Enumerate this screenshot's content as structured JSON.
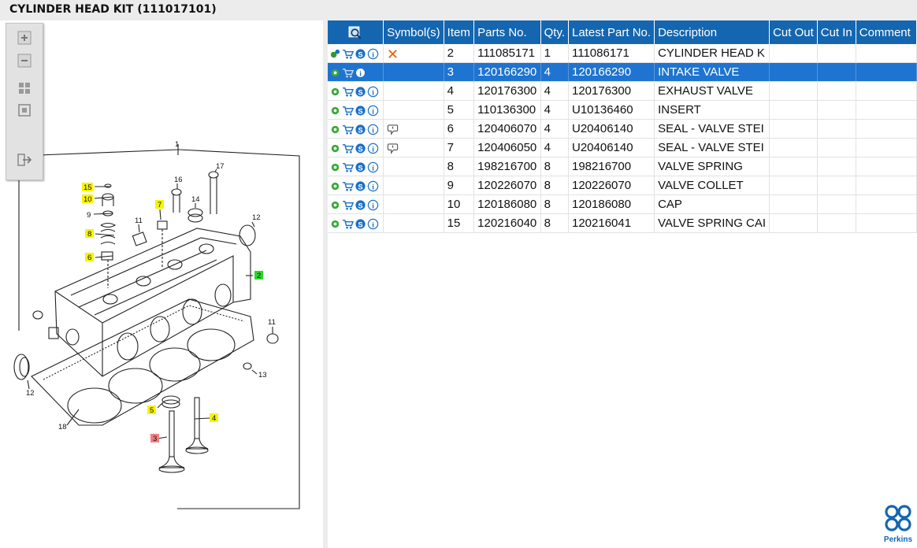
{
  "title": "CYLINDER HEAD KIT (111017101)",
  "table": {
    "headers": [
      "",
      "Symbol(s)",
      "Item",
      "Parts No.",
      "Qty.",
      "Latest Part No.",
      "Description",
      "Cut Out",
      "Cut In",
      "Comment"
    ],
    "rows": [
      {
        "item": "2",
        "parts_no": "111085171",
        "qty": "1",
        "latest": "111086171",
        "desc": "CYLINDER HEAD K",
        "symbol": "x"
      },
      {
        "item": "3",
        "parts_no": "120166290",
        "qty": "4",
        "latest": "120166290",
        "desc": "INTAKE VALVE",
        "symbol": ""
      },
      {
        "item": "4",
        "parts_no": "120176300",
        "qty": "4",
        "latest": "120176300",
        "desc": "EXHAUST VALVE",
        "symbol": ""
      },
      {
        "item": "5",
        "parts_no": "110136300",
        "qty": "4",
        "latest": "U10136460",
        "desc": "INSERT",
        "symbol": ""
      },
      {
        "item": "6",
        "parts_no": "120406070",
        "qty": "4",
        "latest": "U20406140",
        "desc": "SEAL - VALVE STEI",
        "symbol": "note"
      },
      {
        "item": "7",
        "parts_no": "120406050",
        "qty": "4",
        "latest": "U20406140",
        "desc": "SEAL - VALVE STEI",
        "symbol": "note"
      },
      {
        "item": "8",
        "parts_no": "198216700",
        "qty": "8",
        "latest": "198216700",
        "desc": "VALVE SPRING",
        "symbol": ""
      },
      {
        "item": "9",
        "parts_no": "120226070",
        "qty": "8",
        "latest": "120226070",
        "desc": "VALVE COLLET",
        "symbol": ""
      },
      {
        "item": "10",
        "parts_no": "120186080",
        "qty": "8",
        "latest": "120186080",
        "desc": "CAP",
        "symbol": ""
      },
      {
        "item": "15",
        "parts_no": "120216040",
        "qty": "8",
        "latest": "120216041",
        "desc": "VALVE SPRING CAI",
        "symbol": ""
      }
    ]
  },
  "diagram": {
    "callouts": [
      "1",
      "2",
      "3",
      "4",
      "5",
      "6",
      "7",
      "8",
      "9",
      "10",
      "11",
      "11",
      "12",
      "12",
      "13",
      "14",
      "15",
      "16",
      "17",
      "18"
    ]
  },
  "logo": {
    "text": "Perkins"
  },
  "colors": {
    "header_bg": "#1566b0",
    "selected_row": "#1e74d0",
    "highlight_yellow": "#f5f500",
    "highlight_green": "#2bd62b",
    "highlight_red": "#f08080"
  }
}
